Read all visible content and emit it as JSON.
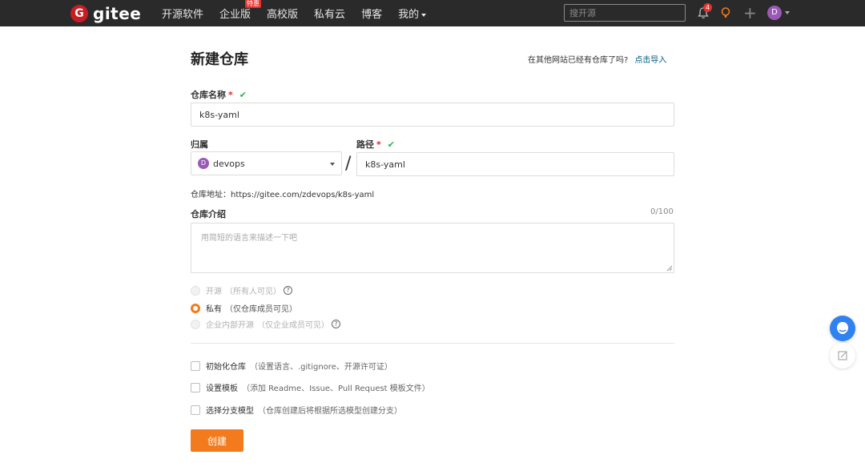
{
  "nav": {
    "logo_mark": "G",
    "logo_text": "gitee",
    "items": [
      {
        "label": "开源软件"
      },
      {
        "label": "企业版",
        "badge": "特惠"
      },
      {
        "label": "高校版"
      },
      {
        "label": "私有云"
      },
      {
        "label": "博客"
      },
      {
        "label": "我的"
      }
    ],
    "search_placeholder": "搜开源",
    "notification_count": "4",
    "avatar_letter": "D"
  },
  "page": {
    "title": "新建仓库",
    "import_hint": "在其他网站已经有仓库了吗?",
    "import_link": "点击导入"
  },
  "form": {
    "repo_name_label": "仓库名称",
    "required_mark": "*",
    "check_mark": "✔",
    "repo_name_value": "k8s-yaml",
    "owner_label": "归属",
    "owner_avatar": "D",
    "owner_value": "devops",
    "slash": "/",
    "path_label": "路径",
    "path_value": "k8s-yaml",
    "repo_url": "仓库地址：https://gitee.com/zdevops/k8s-yaml",
    "intro_label": "仓库介绍",
    "intro_counter": "0/100",
    "intro_placeholder": "用简短的语言来描述一下吧",
    "visibility": [
      {
        "label": "开源",
        "note": "（所有人可见）",
        "selected": false,
        "help": true
      },
      {
        "label": "私有",
        "note": "（仅仓库成员可见）",
        "selected": true,
        "help": false
      },
      {
        "label": "企业内部开源",
        "note": "（仅企业成员可见）",
        "selected": false,
        "help": true
      }
    ],
    "help_glyph": "?",
    "options": [
      {
        "label": "初始化仓库",
        "note": "（设置语言、.gitignore、开源许可证）"
      },
      {
        "label": "设置模板",
        "note": "（添加 Readme、Issue、Pull Request 模板文件）"
      },
      {
        "label": "选择分支模型",
        "note": "（仓库创建后将根据所选模型创建分支）"
      }
    ],
    "submit_label": "创建"
  },
  "colors": {
    "accent": "#f37b1d",
    "link": "#005980",
    "success": "#21ba45",
    "topbar": "#2a2a2b"
  }
}
